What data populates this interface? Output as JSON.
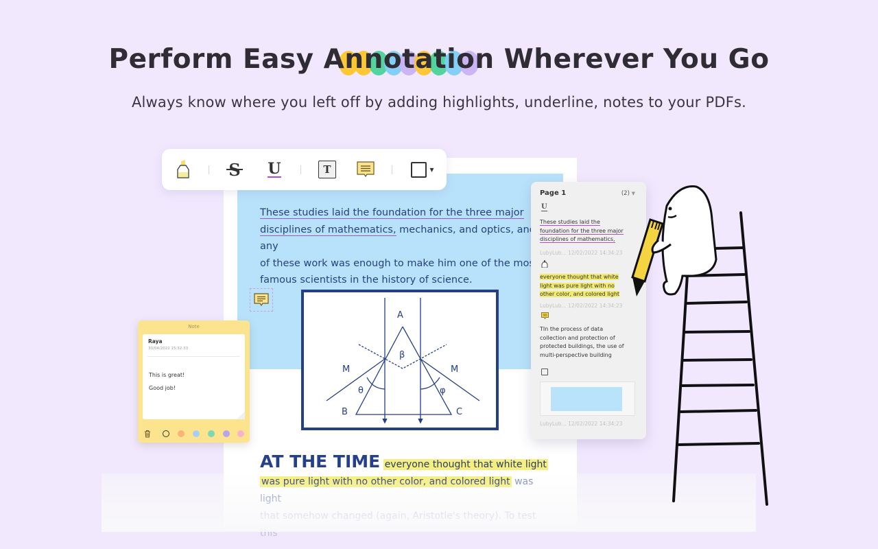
{
  "hero": {
    "title_before": "Perform Easy ",
    "title_highlight": "Annotation",
    "title_after": " Wherever You Go",
    "highlight_colors": [
      "#fdc52a",
      "#fdc52a",
      "#4ad39a",
      "#7dcdf7",
      "#c9b2f4",
      "#fdc52a",
      "#4ad39a",
      "#7dcdf7",
      "#c9b2f4"
    ],
    "subtitle": "Always know where you left off by adding highlights, underline, notes to your PDFs."
  },
  "toolbar": {
    "tools": [
      {
        "name": "highlight",
        "icon": "highlighter-icon"
      },
      {
        "name": "strikethrough",
        "icon": "strikethrough-icon",
        "glyph": "S"
      },
      {
        "name": "underline",
        "icon": "underline-icon",
        "glyph": "U"
      },
      {
        "name": "text-box",
        "icon": "text-box-icon",
        "glyph": "T"
      },
      {
        "name": "sticky-note",
        "icon": "sticky-note-icon"
      },
      {
        "name": "shape",
        "icon": "rectangle-icon"
      }
    ],
    "dropdown_glyph": "▾"
  },
  "document": {
    "paragraph": {
      "underlined_1": "These studies laid the foundation for the three major",
      "underlined_2": "disciplines of mathematics,",
      "rest_2": " mechanics, and optics, and any",
      "line_3": "of these work was enough to make him one of the most",
      "line_4": "famous scientists in the history of science."
    },
    "figure_labels": {
      "A": "A",
      "B": "B",
      "C": "C",
      "M_left": "M",
      "M_right": "M",
      "beta": "β",
      "theta": "θ",
      "phi": "φ"
    },
    "section": {
      "heading": "AT THE TIME",
      "highlight_1": "everyone thought that white light",
      "highlight_2": "was pure light with no other color, and colored light",
      "plain_2": " was light",
      "line_3": "that somehow changed (again, Aristotle's theory). To test this"
    }
  },
  "sticky_note": {
    "title": "Note",
    "author": "Raya",
    "date": "30/04/2022 15:32:33",
    "line_1": "This is great!",
    "line_2": "Good job!",
    "colors": [
      "#f9b47a",
      "#a6cff8",
      "#7dd8b6",
      "#b8a4ec",
      "#f6b3cc"
    ]
  },
  "panel": {
    "page_label": "Page 1",
    "count": "(2)",
    "items": [
      {
        "type": "underline",
        "text_1": "These studies laid the",
        "text_2": "foundation for the three major",
        "text_3": "disciplines of mathematics,",
        "meta": "LubyLub... 12/02/2022 14:34:23"
      },
      {
        "type": "highlight",
        "text_1": "everyone thought that white",
        "text_2": "light was pure light with no",
        "text_3": "other color, and colored light",
        "meta": "LubyLub... 12/02/2022 14:34:23"
      },
      {
        "type": "note",
        "text_1": "TIn the process of data",
        "text_2": "collection and protection of",
        "text_3": "protected buildings, the use of",
        "text_4": "multi-perspective building"
      },
      {
        "type": "shape",
        "meta": "LubyLub... 12/02/2022 14:34:23"
      }
    ]
  },
  "colors": {
    "background": "#f1e8fe",
    "doc_blue": "#b8e2fb",
    "doc_navy": "#253f85",
    "underline_purple": "#b04ad8",
    "highlight_yellow": "#f4ef7e",
    "note_yellow": "#fce48f"
  }
}
